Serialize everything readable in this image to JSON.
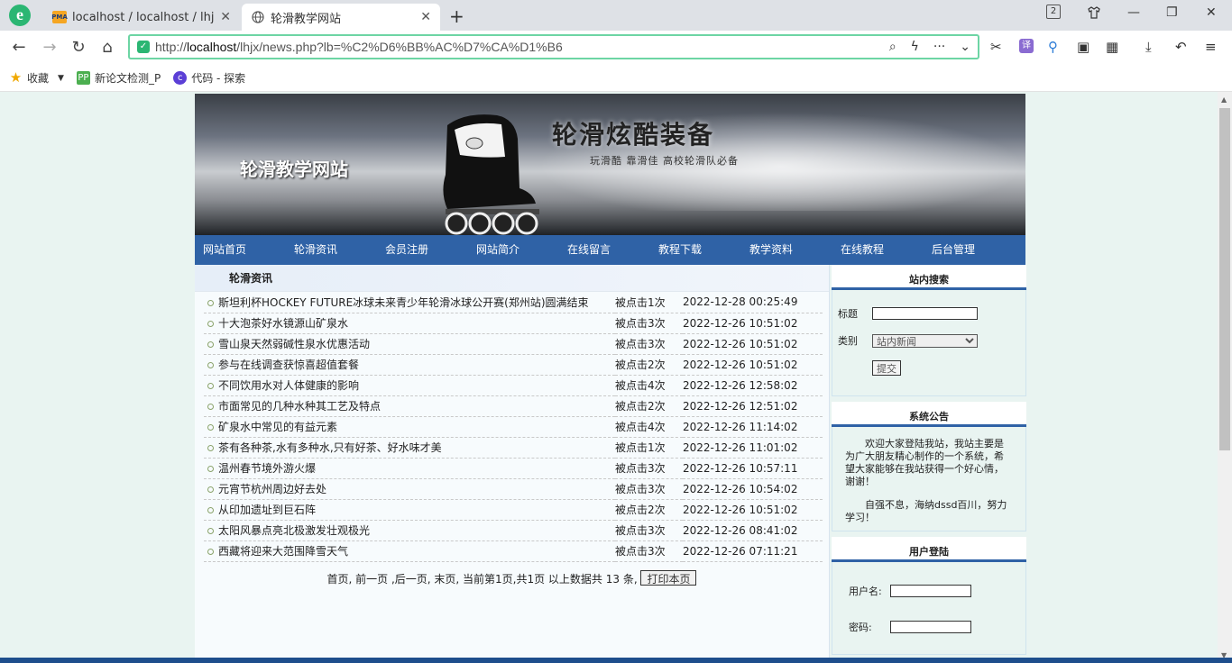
{
  "browser": {
    "tabs": [
      {
        "title": "localhost / localhost / lhjx /",
        "active": false,
        "icon": "pma-icon"
      },
      {
        "title": "轮滑教学网站",
        "active": true,
        "icon": "globe-icon"
      }
    ],
    "tab_count_badge": "2",
    "url_prefix": "http://",
    "url_host": "localhost",
    "url_path": "/lhjx/news.php?lb=%C2%D6%BB%AC%D7%CA%D1%B6",
    "bookmarks": [
      "收藏",
      "新论文检测_P",
      "代码 - 探索"
    ]
  },
  "site": {
    "title": "轮滑教学网站",
    "slogan": "轮滑炫酷装备",
    "subslogan": "玩滑酷 靠滑佳 高校轮滑队必备",
    "nav": [
      "网站首页",
      "轮滑资讯",
      "会员注册",
      "网站简介",
      "在线留言",
      "教程下载",
      "教学资料",
      "在线教程",
      "后台管理"
    ]
  },
  "news": {
    "heading": "轮滑资讯",
    "items": [
      {
        "title": "斯坦利杯HOCKEY FUTURE冰球未来青少年轮滑冰球公开赛(郑州站)圆满结束",
        "hits": "被点击1次",
        "date": "2022-12-28 00:25:49"
      },
      {
        "title": "十大泡茶好水镜源山矿泉水",
        "hits": "被点击3次",
        "date": "2022-12-26 10:51:02"
      },
      {
        "title": "雪山泉天然弱碱性泉水优惠活动",
        "hits": "被点击3次",
        "date": "2022-12-26 10:51:02"
      },
      {
        "title": "参与在线调查获惊喜超值套餐",
        "hits": "被点击2次",
        "date": "2022-12-26 10:51:02"
      },
      {
        "title": "不同饮用水对人体健康的影响",
        "hits": "被点击4次",
        "date": "2022-12-26 12:58:02"
      },
      {
        "title": "市面常见的几种水种其工艺及特点",
        "hits": "被点击2次",
        "date": "2022-12-26 12:51:02"
      },
      {
        "title": "矿泉水中常见的有益元素",
        "hits": "被点击4次",
        "date": "2022-12-26 11:14:02"
      },
      {
        "title": "茶有各种茶,水有多种水,只有好茶、好水味才美",
        "hits": "被点击1次",
        "date": "2022-12-26 11:01:02"
      },
      {
        "title": "温州春节境外游火爆",
        "hits": "被点击3次",
        "date": "2022-12-26 10:57:11"
      },
      {
        "title": "元宵节杭州周边好去处",
        "hits": "被点击3次",
        "date": "2022-12-26 10:54:02"
      },
      {
        "title": "从印加遗址到巨石阵",
        "hits": "被点击2次",
        "date": "2022-12-26 10:51:02"
      },
      {
        "title": "太阳风暴点亮北极激发壮观极光",
        "hits": "被点击3次",
        "date": "2022-12-26 08:41:02"
      },
      {
        "title": "西藏将迎来大范围降雪天气",
        "hits": "被点击3次",
        "date": "2022-12-26 07:11:21"
      }
    ],
    "pager_text": "首页, 前一页 ,后一页, 末页, 当前第1页,共1页 以上数据共 13 条,",
    "print_button": "打印本页"
  },
  "sidebar": {
    "search": {
      "heading": "站内搜索",
      "title_label": "标题",
      "title_value": "",
      "category_label": "类别",
      "category_value": "站内新闻",
      "submit": "提交"
    },
    "notice": {
      "heading": "系统公告",
      "paragraphs": [
        "欢迎大家登陆我站，我站主要是为广大朋友精心制作的一个系统，希望大家能够在我站获得一个好心情，谢谢！",
        "自强不息，海纳dssd百川，努力学习！"
      ]
    },
    "login": {
      "heading": "用户登陆",
      "username_label": "用户名:",
      "password_label": "密码:"
    }
  },
  "colors": {
    "nav_bg": "#2f62a6",
    "url_border": "#6dd5a4",
    "page_bg": "#e9f4f1"
  }
}
